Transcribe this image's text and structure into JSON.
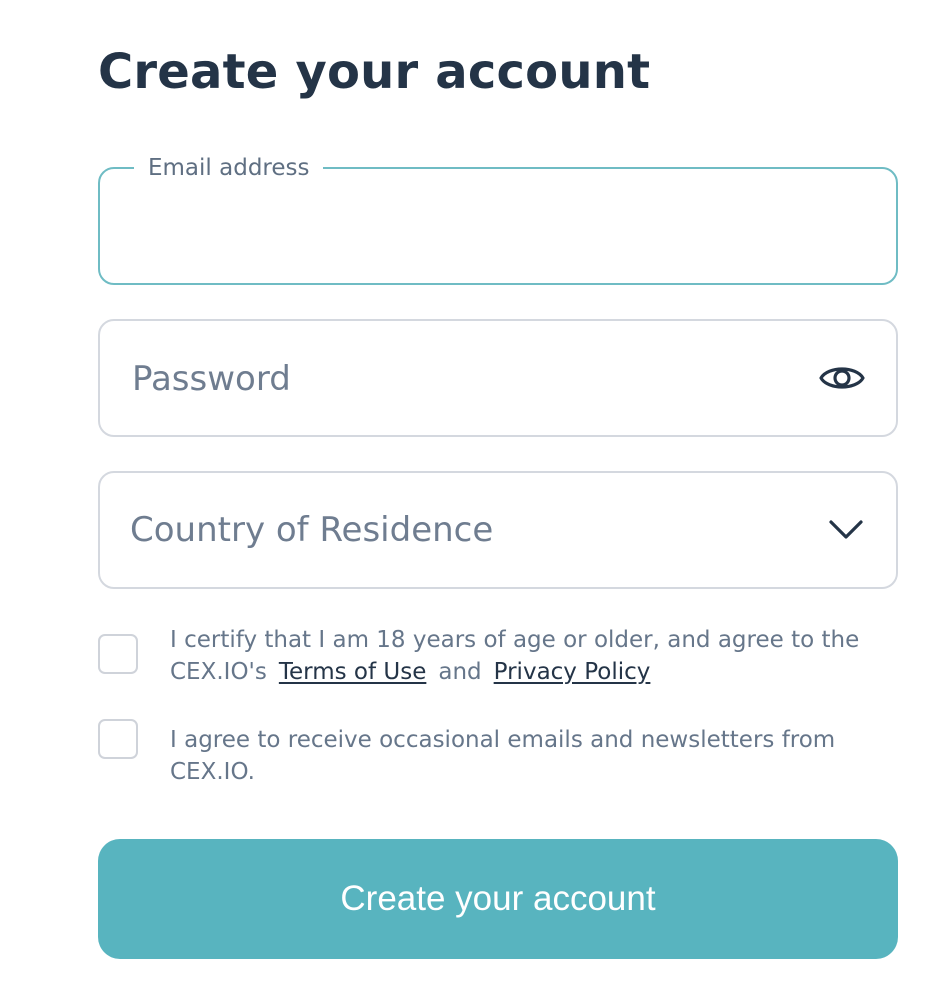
{
  "form": {
    "title": "Create your account",
    "email": {
      "label": "Email address",
      "value": ""
    },
    "password": {
      "placeholder": "Password",
      "toggle_icon": "eye-icon"
    },
    "country": {
      "placeholder": "Country of Residence",
      "dropdown_icon": "chevron-down-icon"
    },
    "terms_checkbox": {
      "checked": false,
      "text_line1": "I certify that I am 18 years of age or older, and agree to the",
      "text_prefix": "CEX.IO's",
      "terms_link": "Terms of Use",
      "conjunction": "and",
      "privacy_link": "Privacy Policy"
    },
    "newsletter_checkbox": {
      "checked": false,
      "text": "I agree to receive occasional emails and newsletters from CEX.IO."
    },
    "submit_label": "Create your account"
  },
  "colors": {
    "accent": "#58b4bf",
    "focus_border": "#6fbcc4",
    "title": "#243447",
    "muted_text": "#6f7d90"
  }
}
